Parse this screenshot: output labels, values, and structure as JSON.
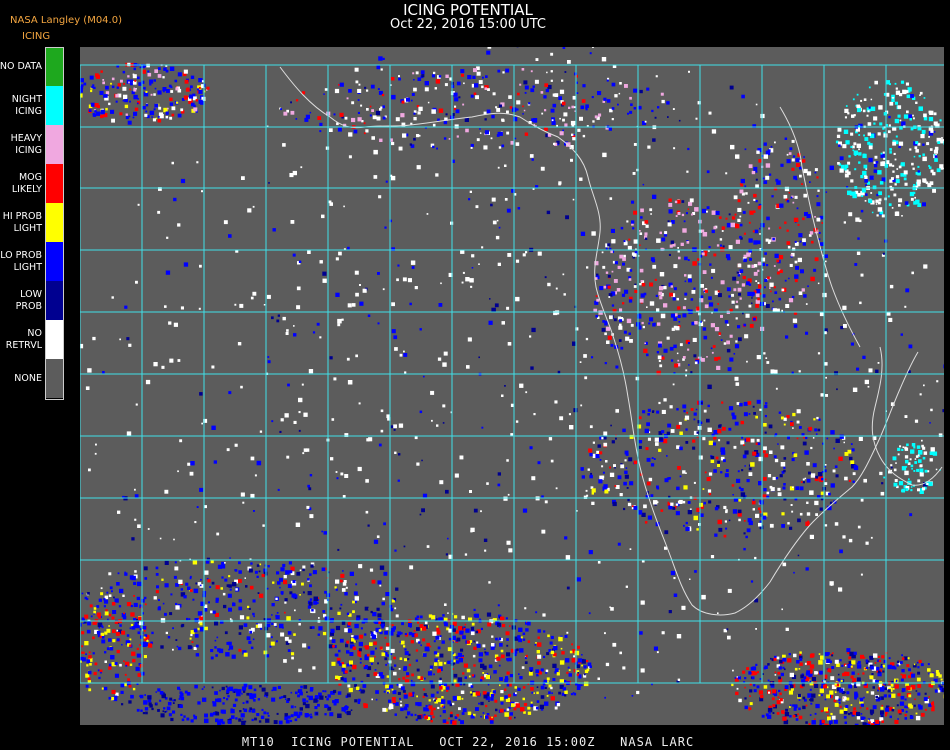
{
  "header": {
    "organization": "NASA Langley (M04.0)",
    "product_label": "ICING",
    "title": "ICING POTENTIAL",
    "subtitle": "Oct 22, 2016 15:00 UTC"
  },
  "legend": {
    "items": [
      {
        "label": "NO DATA",
        "color": "#1ea81e"
      },
      {
        "label": "NIGHT\nICING",
        "color": "#00ffff"
      },
      {
        "label": "HEAVY\nICING",
        "color": "#f0a8e0"
      },
      {
        "label": "MOG\nLIKELY",
        "color": "#ff0000"
      },
      {
        "label": "HI PROB\nLIGHT",
        "color": "#ffff00"
      },
      {
        "label": "LO PROB\nLIGHT",
        "color": "#0000ff"
      },
      {
        "label": "LOW\nPROB",
        "color": "#000090"
      },
      {
        "label": "NO\nRETRVL",
        "color": "#ffffff"
      },
      {
        "label": "NONE",
        "color": "#5c5c5c"
      }
    ]
  },
  "map": {
    "background_color": "#5c5c5c",
    "grid_color": "#40e0e8",
    "coast_color": "#dddddd"
  },
  "footer": "MT10  ICING POTENTIAL   OCT 22, 2016 15:00Z   NASA LARC"
}
